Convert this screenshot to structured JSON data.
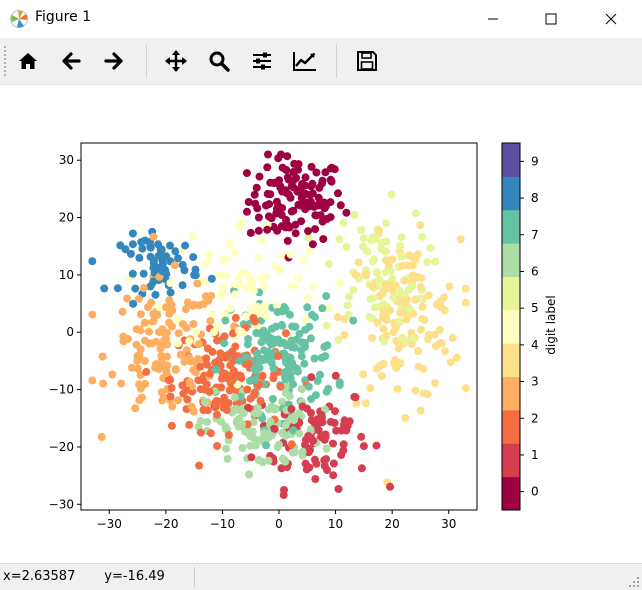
{
  "window": {
    "title": "Figure 1",
    "icon": "matplotlib-logo-icon"
  },
  "toolbar": {
    "buttons": [
      {
        "icon": "home-icon",
        "name": "home-button"
      },
      {
        "icon": "back-arrow-icon",
        "name": "back-button"
      },
      {
        "icon": "forward-arrow-icon",
        "name": "forward-button"
      },
      {
        "icon": "pan-move-icon",
        "name": "pan-button"
      },
      {
        "icon": "zoom-magnifier-icon",
        "name": "zoom-button"
      },
      {
        "icon": "configure-subplots-icon",
        "name": "subplots-button"
      },
      {
        "icon": "edit-axis-icon",
        "name": "edit-axis-button"
      },
      {
        "icon": "save-floppy-icon",
        "name": "save-button"
      }
    ]
  },
  "status": {
    "coords": "x=2.63587       y=-16.49"
  },
  "chart_data": {
    "type": "scatter",
    "title": "",
    "xlabel": "",
    "ylabel": "",
    "xlim": [
      -35,
      35
    ],
    "ylim": [
      -31,
      33
    ],
    "xticks": [
      -30,
      -20,
      -10,
      0,
      10,
      20,
      30
    ],
    "yticks": [
      -30,
      -20,
      -10,
      0,
      10,
      20,
      30
    ],
    "grid": false,
    "colorbar": {
      "label": "digit label",
      "ticks": [
        "0",
        "1",
        "2",
        "3",
        "4",
        "5",
        "6",
        "7",
        "8",
        "9"
      ],
      "colors": [
        "#9e0142",
        "#d53e4f",
        "#f46d43",
        "#fdae61",
        "#fee08b",
        "#ffffbf",
        "#e6f598",
        "#abdda4",
        "#66c2a5",
        "#3288bd",
        "#5e4fa2"
      ]
    },
    "series": [
      {
        "label": 0,
        "center": [
          3,
          23
        ],
        "spread": [
          4.2,
          3.8
        ],
        "n": 120
      },
      {
        "label": 1,
        "center": [
          6,
          -18
        ],
        "spread": [
          5.0,
          4.5
        ],
        "n": 90
      },
      {
        "label": 2,
        "center": [
          -9,
          -8
        ],
        "spread": [
          5.0,
          4.5
        ],
        "n": 150
      },
      {
        "label": 3,
        "center": [
          -20,
          -3
        ],
        "spread": [
          5.0,
          6.0
        ],
        "n": 130
      },
      {
        "label": 4,
        "center": [
          22,
          2
        ],
        "spread": [
          5.0,
          7.0
        ],
        "n": 130
      },
      {
        "label": 5,
        "center": [
          -6,
          8
        ],
        "spread": [
          7.0,
          6.0
        ],
        "n": 90
      },
      {
        "label": 6,
        "center": [
          17,
          10
        ],
        "spread": [
          4.5,
          6.0
        ],
        "n": 80
      },
      {
        "label": 7,
        "center": [
          -3,
          -17
        ],
        "spread": [
          5.0,
          3.5
        ],
        "n": 110
      },
      {
        "label": 8,
        "center": [
          0,
          -4
        ],
        "spread": [
          5.0,
          5.0
        ],
        "n": 150
      },
      {
        "label": 9,
        "center": [
          -21,
          12
        ],
        "spread": [
          3.5,
          2.5
        ],
        "n": 60
      }
    ]
  }
}
